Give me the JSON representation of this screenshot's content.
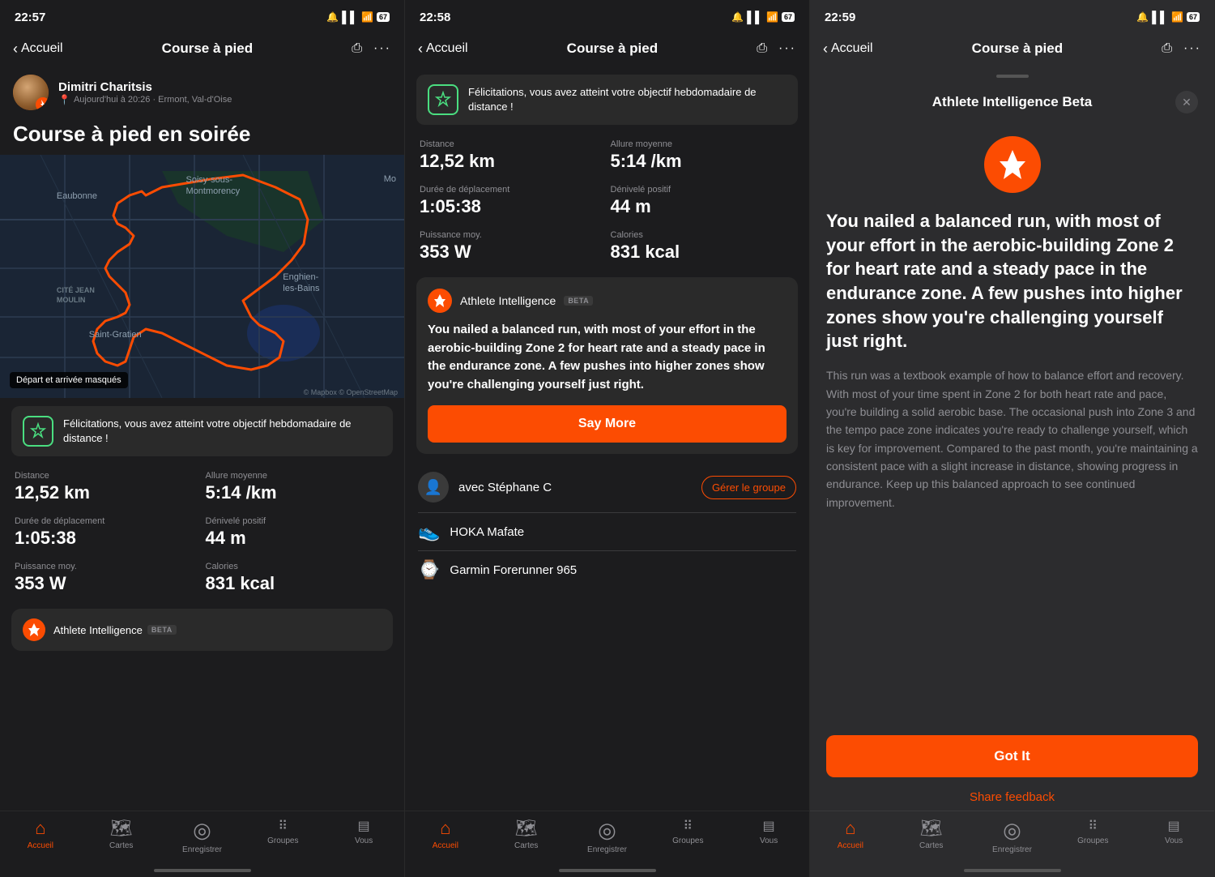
{
  "panels": [
    {
      "id": "panel1",
      "status": {
        "time": "22:57",
        "signal": "▌▌",
        "wifi": "wifi",
        "battery": "67"
      },
      "nav": {
        "back": "Accueil",
        "title": "Course à pied"
      },
      "user": {
        "name": "Dimitri Charitsis",
        "meta": "Aujourd'hui à 20:26 · Ermont, Val-d'Oise"
      },
      "activityTitle": "Course à pied en soirée",
      "mapMask": "Départ et arrivée masqués",
      "mapLabels": [
        {
          "text": "Eaubonne",
          "top": "15%",
          "left": "20%"
        },
        {
          "text": "Soisy-sous-\nMontmorency",
          "top": "10%",
          "left": "48%"
        },
        {
          "text": "Enghien-\nles-Bains",
          "top": "52%",
          "left": "72%"
        },
        {
          "text": "Saint-Gratien",
          "top": "72%",
          "left": "28%"
        },
        {
          "text": "CITÉ JEAN\nMOULIN",
          "top": "55%",
          "left": "20%"
        }
      ],
      "congrats": {
        "text": "Félicitations, vous avez atteint votre objectif hebdomadaire de distance !"
      },
      "stats": [
        {
          "label": "Distance",
          "value": "12,52 km"
        },
        {
          "label": "Allure moyenne",
          "value": "5:14 /km"
        },
        {
          "label": "Durée de déplacement",
          "value": "1:05:38"
        },
        {
          "label": "Dénivelé positif",
          "value": "44 m"
        },
        {
          "label": "Puissance moy.",
          "value": "353 W"
        },
        {
          "label": "Calories",
          "value": "831 kcal"
        }
      ],
      "aiCard": {
        "label": "Athlete Intelligence",
        "beta": "BETA"
      },
      "tabs": [
        {
          "icon": "🏠",
          "label": "Accueil",
          "active": true
        },
        {
          "icon": "🗺",
          "label": "Cartes",
          "active": false
        },
        {
          "icon": "⊙",
          "label": "Enregistrer",
          "active": false
        },
        {
          "icon": "••",
          "label": "Groupes",
          "active": false
        },
        {
          "icon": "☰",
          "label": "Vous",
          "active": false
        }
      ]
    },
    {
      "id": "panel2",
      "status": {
        "time": "22:58",
        "battery": "67"
      },
      "nav": {
        "back": "Accueil",
        "title": "Course à pied"
      },
      "congrats": {
        "text": "Félicitations, vous avez atteint votre objectif hebdomadaire de distance !"
      },
      "stats": [
        {
          "label": "Distance",
          "value": "12,52 km"
        },
        {
          "label": "Allure moyenne",
          "value": "5:14 /km"
        },
        {
          "label": "Durée de déplacement",
          "value": "1:05:38"
        },
        {
          "label": "Dénivelé positif",
          "value": "44 m"
        },
        {
          "label": "Puissance moy.",
          "value": "353 W"
        },
        {
          "label": "Calories",
          "value": "831 kcal"
        }
      ],
      "aiCard": {
        "label": "Athlete Intelligence",
        "beta": "BETA",
        "body": "You nailed a balanced run, with most of your effort in the aerobic-building Zone 2 for heart rate and a steady pace in the endurance zone. A few pushes into higher zones show you're challenging yourself just right.",
        "sayMore": "Say More"
      },
      "companion": {
        "name": "avec Stéphane C",
        "manageBtn": "Gérer le groupe"
      },
      "gear": [
        {
          "name": "HOKA Mafate",
          "icon": "👟"
        },
        {
          "name": "Garmin Forerunner 965",
          "icon": "⌚"
        }
      ],
      "tabs": [
        {
          "icon": "🏠",
          "label": "Accueil",
          "active": true
        },
        {
          "icon": "🗺",
          "label": "Cartes",
          "active": false
        },
        {
          "icon": "⊙",
          "label": "Enregistrer",
          "active": false
        },
        {
          "icon": "••",
          "label": "Groupes",
          "active": false
        },
        {
          "icon": "☰",
          "label": "Vous",
          "active": false
        }
      ]
    },
    {
      "id": "panel3",
      "status": {
        "time": "22:59",
        "battery": "67"
      },
      "nav": {
        "back": "Accueil",
        "title": "Course à pied"
      },
      "modal": {
        "title": "Athlete Intelligence Beta",
        "headline": "You nailed a balanced run, with most of your effort in the aerobic-building Zone 2 for heart rate and a steady pace in the endurance zone. A few pushes into higher zones show you're challenging yourself just right.",
        "detail": "This run was a textbook example of how to balance effort and recovery. With most of your time spent in Zone 2 for both heart rate and pace, you're building a solid aerobic base. The occasional push into Zone 3 and the tempo pace zone indicates you're ready to challenge yourself, which is key for improvement. Compared to the past month, you're maintaining a consistent pace with a slight increase in distance, showing progress in endurance. Keep up this balanced approach to see continued improvement.",
        "gotIt": "Got It",
        "shareFeedback": "Share feedback"
      },
      "tabs": [
        {
          "icon": "🏠",
          "label": "Accueil",
          "active": true
        },
        {
          "icon": "🗺",
          "label": "Cartes",
          "active": false
        },
        {
          "icon": "⊙",
          "label": "Enregistrer",
          "active": false
        },
        {
          "icon": "••",
          "label": "Groupes",
          "active": false
        },
        {
          "icon": "☰",
          "label": "Vous",
          "active": false
        }
      ]
    }
  ]
}
